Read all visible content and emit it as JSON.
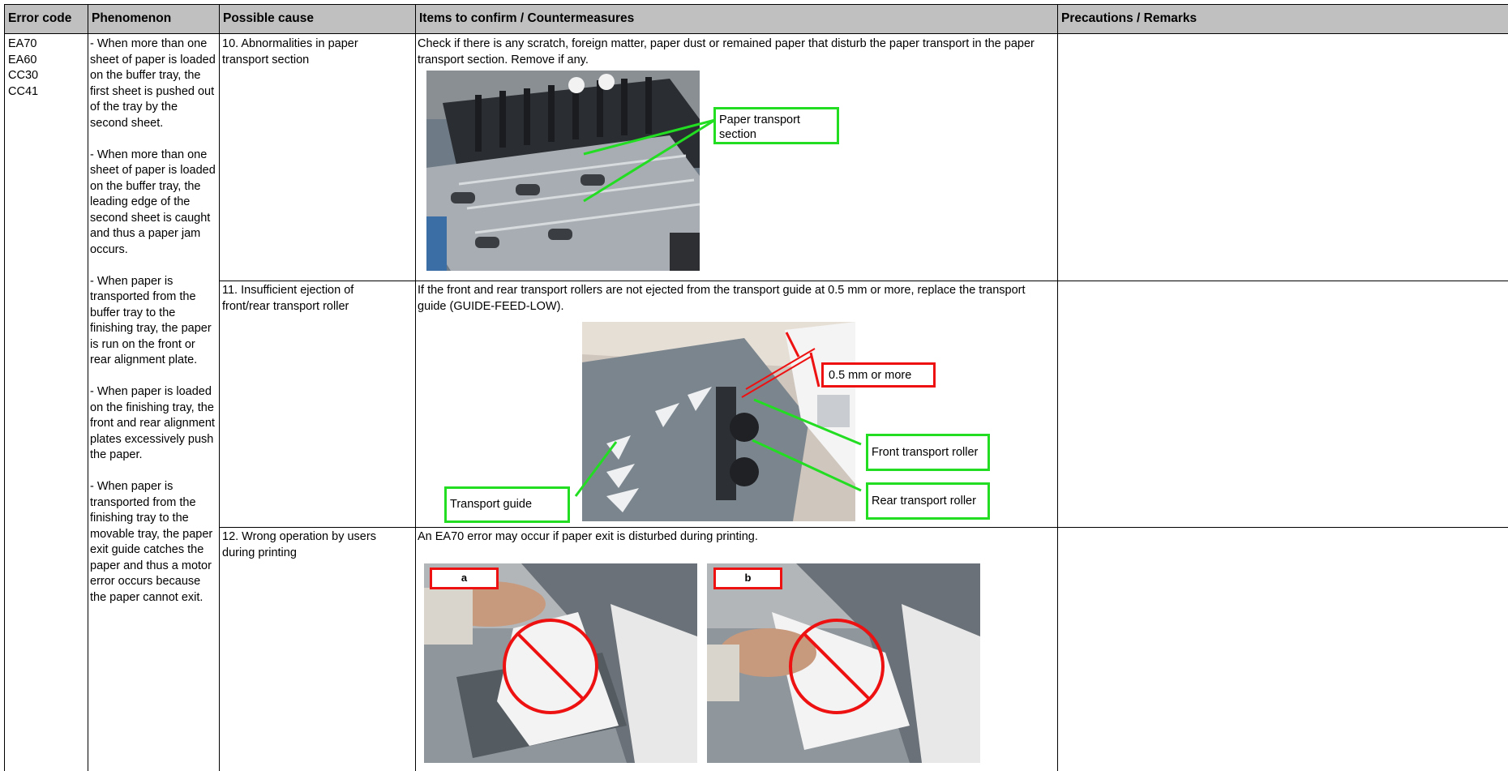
{
  "headers": {
    "error_code": "Error code",
    "phenomenon": "Phenomenon",
    "possible_cause": "Possible cause",
    "items": "Items to confirm / Countermeasures",
    "precautions": "Precautions / Remarks"
  },
  "error_codes": [
    "EA70",
    "EA60",
    "CC30",
    "CC41"
  ],
  "phenomenon": [
    "- When more than one sheet of paper is loaded on the buffer tray, the first sheet is pushed out of the tray by the second sheet.",
    "- When more than one sheet of paper is loaded on the buffer tray, the leading edge of the second sheet is caught and thus a paper jam occurs.",
    "- When paper is transported from the buffer tray to the finishing tray, the paper is run on the front or rear alignment plate.",
    "- When paper is loaded on the finishing tray, the front and rear alignment plates excessively push the paper.",
    "- When paper is transported from the finishing tray to the movable tray, the paper exit guide catches the paper and thus a motor error occurs because the paper cannot exit."
  ],
  "rows": [
    {
      "cause": "10. Abnormalities in paper transport section",
      "text": "Check if there is any scratch, foreign matter, paper dust or remained paper that disturb the paper transport in the paper transport section. Remove if any.",
      "callouts": [
        "Paper transport section"
      ],
      "remarks": ""
    },
    {
      "cause": "11. Insufficient ejection of front/rear transport roller",
      "text": "If the front and rear transport rollers are not ejected from the transport guide at 0.5 mm or more, replace the transport guide (GUIDE-FEED-LOW).",
      "callouts": [
        "0.5 mm or more",
        "Front transport roller",
        "Rear transport roller",
        "Transport guide"
      ],
      "remarks": ""
    },
    {
      "cause": "12. Wrong operation by users during printing",
      "text": "An EA70 error may occur if paper exit is disturbed during printing.",
      "tags": [
        "a",
        "b"
      ],
      "remarks": ""
    }
  ],
  "colors": {
    "header_bg": "#c0c0c0",
    "callout_green": "#22dd22",
    "callout_red": "#ee1111"
  }
}
